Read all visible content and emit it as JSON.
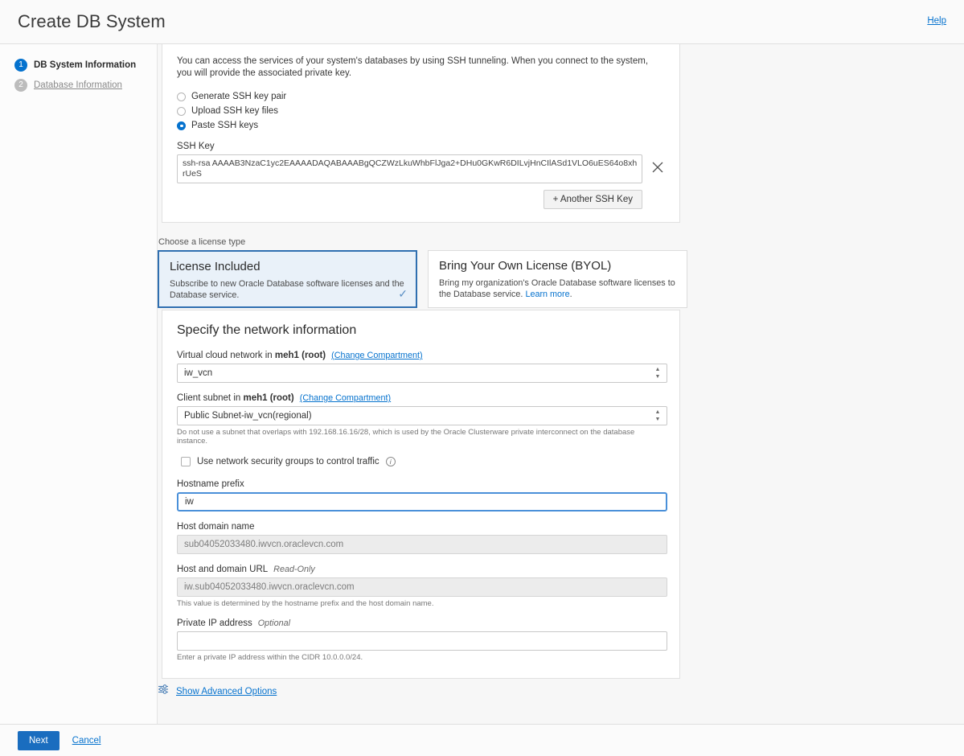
{
  "header": {
    "title": "Create DB System",
    "help_label": "Help"
  },
  "sidebar": {
    "steps": [
      {
        "number": "1",
        "label": "DB System Information",
        "state": "active"
      },
      {
        "number": "2",
        "label": "Database Information",
        "state": "inactive"
      }
    ]
  },
  "ssh": {
    "intro": "You can access the services of your system's databases by using SSH tunneling. When you connect to the system, you will provide the associated private key.",
    "options": [
      {
        "label": "Generate SSH key pair",
        "checked": false
      },
      {
        "label": "Upload SSH key files",
        "checked": false
      },
      {
        "label": "Paste SSH keys",
        "checked": true
      }
    ],
    "key_label": "SSH Key",
    "key_value": "ssh-rsa AAAAB3NzaC1yc2EAAAADAQABAAABgQCZWzLkuWhbFlJga2+DHu0GKwR6DILvjHnCIlASd1VLO6uES64o8xhrUeS",
    "remove_icon": "close-icon",
    "add_key_label": "+ Another SSH Key"
  },
  "license": {
    "caption": "Choose a license type",
    "cards": [
      {
        "title": "License Included",
        "desc": "Subscribe to new Oracle Database software licenses and the Database service.",
        "selected": true,
        "check_glyph": "✓"
      },
      {
        "title": "Bring Your Own License (BYOL)",
        "desc": "Bring my organization's Oracle Database software licenses to the Database service. ",
        "link_label": "Learn more",
        "desc_tail": ".",
        "selected": false
      }
    ]
  },
  "network": {
    "title": "Specify the network information",
    "vcn": {
      "label_prefix": "Virtual cloud network in ",
      "label_bold": "meh1 (root)",
      "change_link": "(Change Compartment)",
      "value": "iw_vcn"
    },
    "subnet": {
      "label_prefix": "Client subnet in ",
      "label_bold": "meh1 (root)",
      "change_link": "(Change Compartment)",
      "value": "Public Subnet-iw_vcn(regional)",
      "hint": "Do not use a subnet that overlaps with 192.168.16.16/28, which is used by the Oracle Clusterware private interconnect on the database instance."
    },
    "nsg": {
      "label": "Use network security groups to control traffic",
      "checked": false,
      "info_glyph": "i"
    },
    "hostname_prefix": {
      "label": "Hostname prefix",
      "value": "iw",
      "focused": true
    },
    "host_domain": {
      "label": "Host domain name",
      "value": "sub04052033480.iwvcn.oraclevcn.com"
    },
    "host_url": {
      "label": "Host and domain URL",
      "readonly_tag": "Read-Only",
      "value": "iw.sub04052033480.iwvcn.oraclevcn.com",
      "hint": "This value is determined by the hostname prefix and the host domain name."
    },
    "private_ip": {
      "label": "Private IP address",
      "optional_tag": "Optional",
      "value": "",
      "hint": "Enter a private IP address within the CIDR 10.0.0.0/24."
    }
  },
  "advanced": {
    "label": "Show Advanced Options",
    "icon": "sliders-icon"
  },
  "footer": {
    "next_label": "Next",
    "cancel_label": "Cancel"
  },
  "colors": {
    "accent": "#0572ce",
    "primary_button": "#1a6dbf",
    "selected_card_bg": "#e9f1f9",
    "selected_card_border": "#2f6fb0"
  }
}
